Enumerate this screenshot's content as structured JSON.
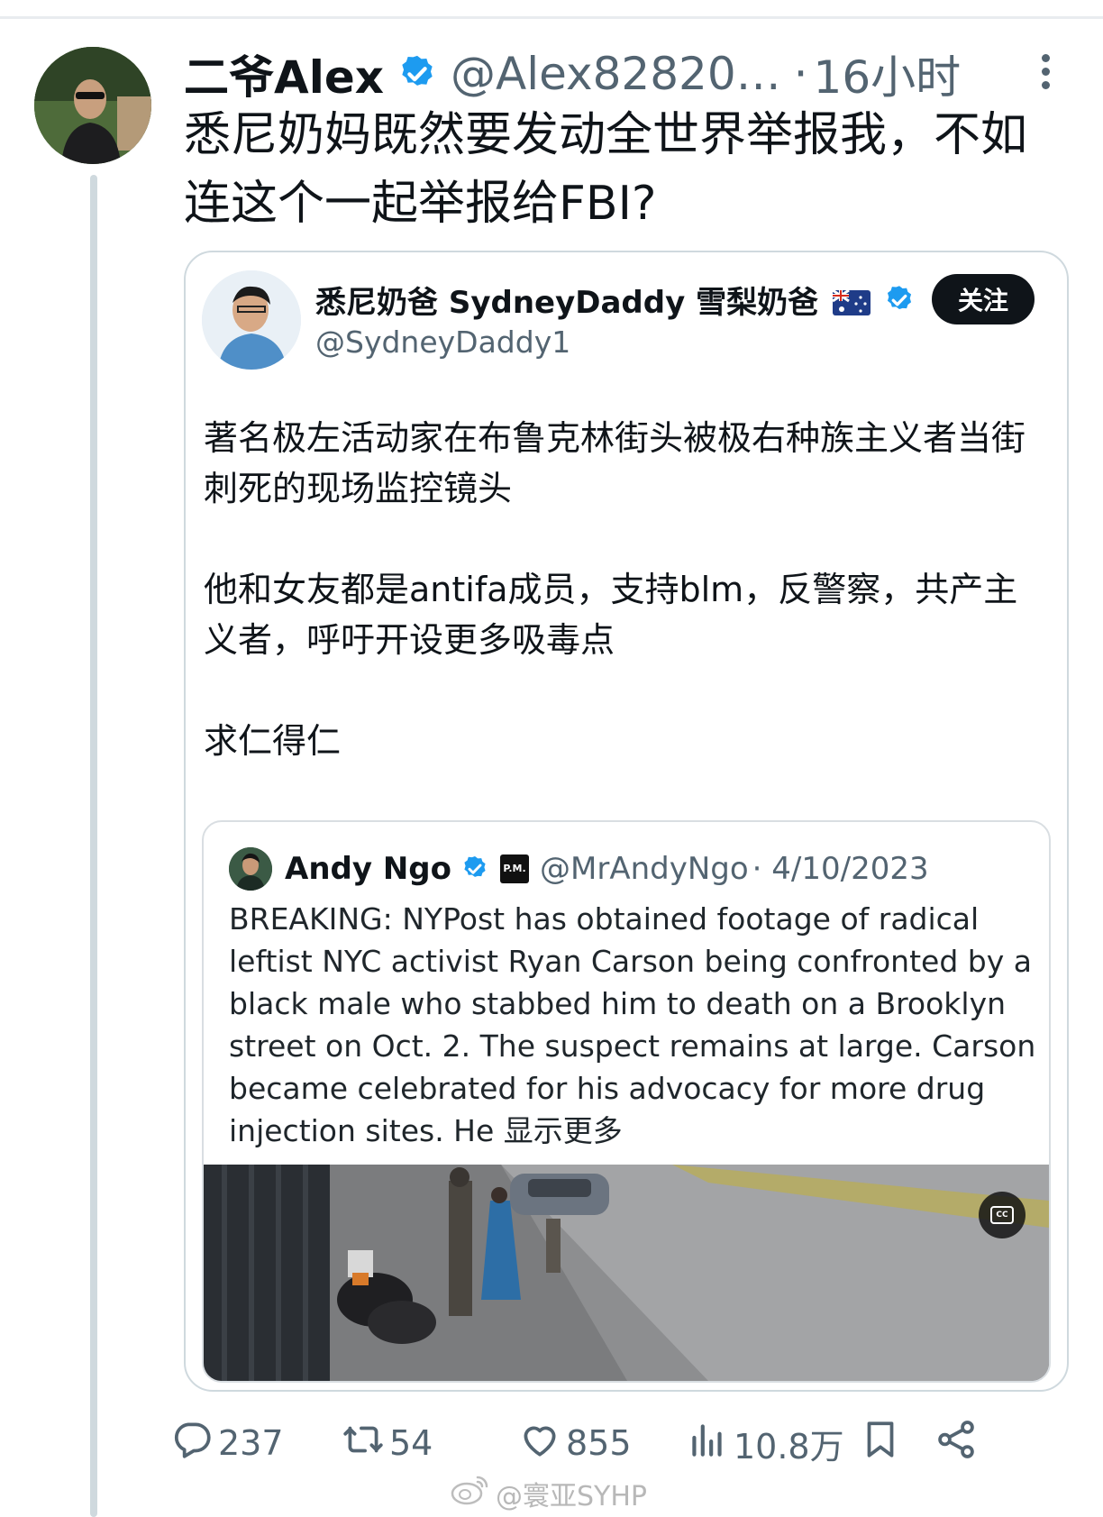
{
  "author": {
    "name": "二爷Alex",
    "handle": "@Alex82820…",
    "separator": "·",
    "time": "16小时"
  },
  "tweet": {
    "text": "悉尼奶妈既然要发动全世界举报我，不如连这个一起举报给FBI?"
  },
  "quoted": {
    "name": "悉尼奶爸 SydneyDaddy 雪梨奶爸",
    "handle": "@SydneyDaddy1",
    "follow_label": "关注",
    "paragraphs": [
      "著名极左活动家在布鲁克林街头被极右种族主义者当街刺死的现场监控镜头",
      "他和女友都是antifa成员，支持blm，反警察，共产主义者，呼吁开设更多吸毒点",
      "求仁得仁"
    ]
  },
  "inner_quote": {
    "name": "Andy Ngo",
    "pm_badge": "P.M.",
    "handle": "@MrAndyNgo",
    "date": "· 4/10/2023",
    "text": "BREAKING: NYPost has obtained footage of radical leftist NYC activist Ryan Carson being confronted by a black male who stabbed him to death on a Brooklyn street on Oct. 2. The suspect remains at large. Carson became celebrated for his advocacy for more drug injection sites. He ",
    "show_more": "显示更多",
    "video_cc_label": "CC"
  },
  "actions": {
    "replies": "237",
    "retweets": "54",
    "likes": "855",
    "views": "10.8万"
  },
  "watermark": "@寰亚SYHP",
  "colors": {
    "verified_blue": "#1d9bf0",
    "secondary_text": "#536471",
    "follow_button_bg": "#0f1419"
  },
  "icons": {
    "verified": "verified-badge-icon",
    "more": "more-vertical-icon",
    "reply": "reply-bubble-icon",
    "retweet": "retweet-icon",
    "like": "heart-icon",
    "views": "bar-chart-icon",
    "bookmark": "bookmark-icon",
    "share": "share-icon",
    "flag": "australia-flag-icon",
    "cc": "closed-captions-icon",
    "weibo": "weibo-logo-icon"
  }
}
